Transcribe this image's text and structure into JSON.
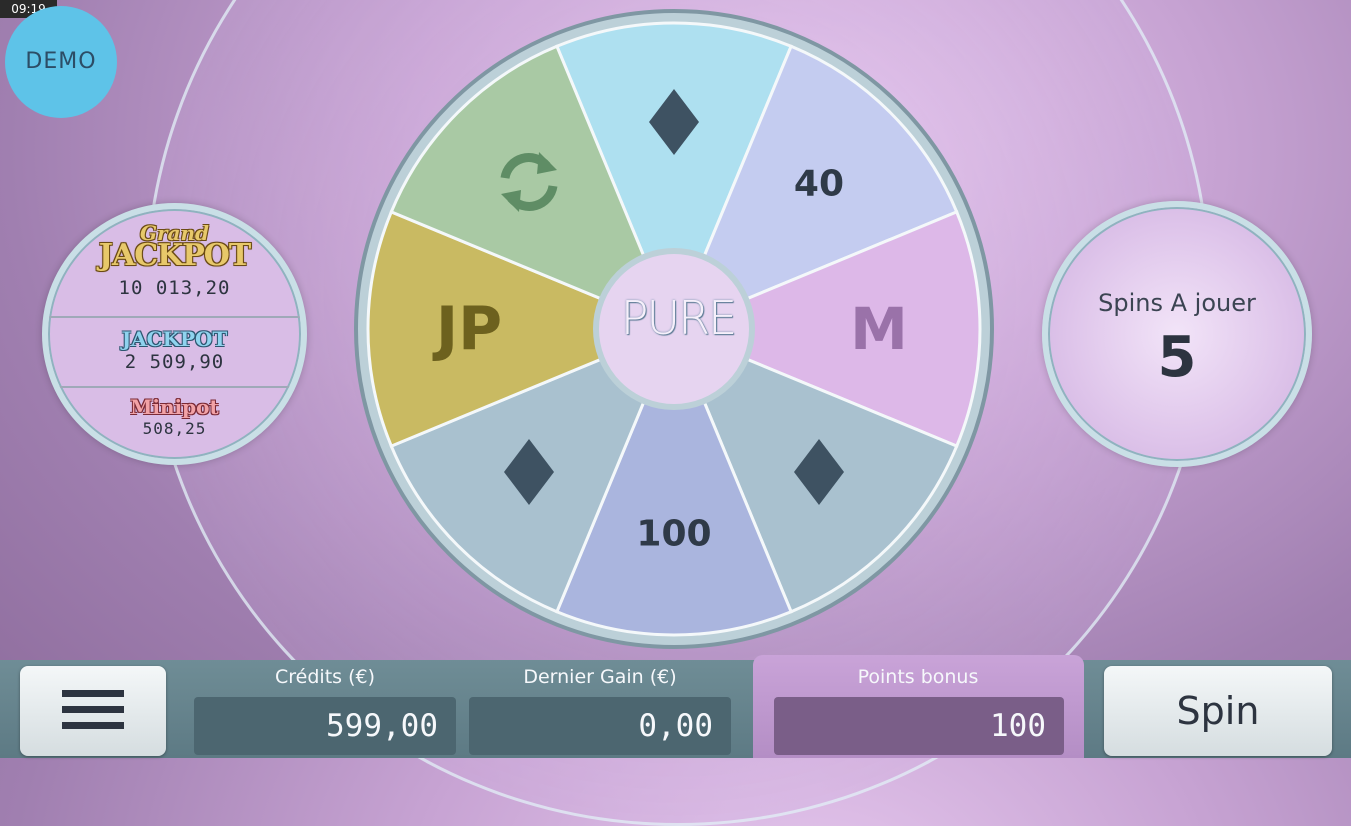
{
  "status_bar": {
    "time": "09:19"
  },
  "demo_badge": "DEMO",
  "jackpots": [
    {
      "top": "Grand",
      "title": "JACKPOT",
      "value": "10 013,20"
    },
    {
      "title": "JACKPOT",
      "value": "2 509,90"
    },
    {
      "title": "Minipot",
      "value": "508,25"
    }
  ],
  "wheel": {
    "hub_label": "PURE",
    "segments": [
      {
        "kind": "icon",
        "icon": "diamond-icon",
        "color": "#aee0f0"
      },
      {
        "kind": "text",
        "label": "40",
        "color": "#c4ccf0"
      },
      {
        "kind": "text",
        "label": "M",
        "color": "#ddb8e8"
      },
      {
        "kind": "icon",
        "icon": "diamond-icon",
        "color": "#a9c1cf"
      },
      {
        "kind": "text",
        "label": "100",
        "color": "#aab5de"
      },
      {
        "kind": "icon",
        "icon": "diamond-icon",
        "color": "#a9c1cf"
      },
      {
        "kind": "text",
        "label": "JP",
        "color": "#c9ba62"
      },
      {
        "kind": "icon",
        "icon": "refresh-icon",
        "color": "#a9c9a4"
      }
    ]
  },
  "spins": {
    "label": "Spins A jouer",
    "count": "5"
  },
  "bottom": {
    "credits_label": "Crédits (€)",
    "credits_value": "599,00",
    "last_win_label": "Dernier Gain (€)",
    "last_win_value": "0,00",
    "bonus_label": "Points bonus",
    "bonus_value": "100",
    "spin_label": "Spin"
  }
}
